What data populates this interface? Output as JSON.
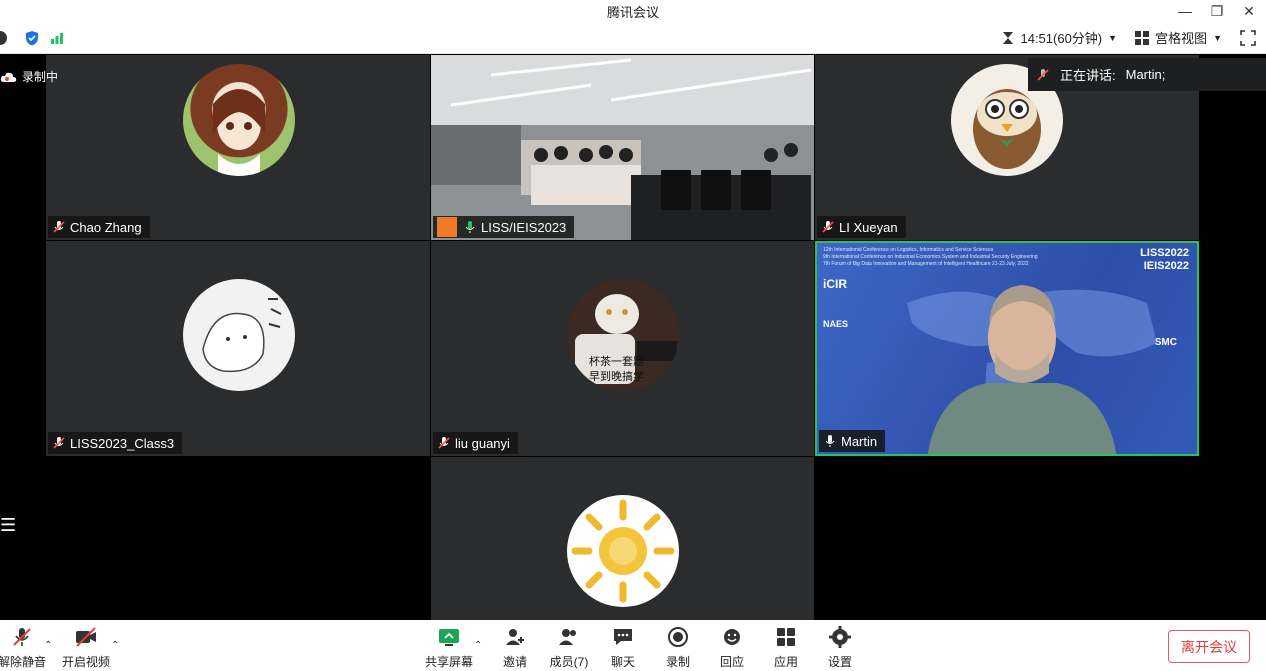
{
  "window": {
    "title": "腾讯会议"
  },
  "top": {
    "time_label": "14:51(60分钟)",
    "view_label": "宫格视图"
  },
  "recording_label": "录制中",
  "speaking": {
    "prefix": "正在讲话:",
    "name": "Martin;"
  },
  "tiles": [
    {
      "name": "Chao Zhang"
    },
    {
      "name": "LISS/IEIS2023"
    },
    {
      "name": "LI Xueyan"
    },
    {
      "name": "LISS2023_Class3"
    },
    {
      "name": "liu guanyi"
    },
    {
      "name": "Martin"
    }
  ],
  "cat_caption": {
    "line1": "杯茶一套题",
    "line2": "早到晚搞学"
  },
  "slide": {
    "logo1": "LISS2022",
    "logo2": "IEIS2022",
    "line1": "12th International Conference on Logistics, Informatics and Service Sciences",
    "line2": "9th International Conference on Industrial Economics System and Industrial Security Engineering",
    "line3": "7th Forum of Big Data Innovation and Management of Intelligent Healthcare  21-23 July, 2022",
    "org1": "iCIR",
    "org2": "NAES",
    "org3": "SMC"
  },
  "bottom": {
    "unmute": "解除静音",
    "video": "开启视频",
    "share": "共享屏幕",
    "invite": "邀请",
    "members": "成员(7)",
    "chat": "聊天",
    "record": "录制",
    "replay": "回应",
    "apps": "应用",
    "settings": "设置",
    "leave": "离开会议"
  },
  "colors": {
    "accent_green": "#22c55e",
    "leave_red": "#e23b3b",
    "tile_bg": "#2b2c2e"
  }
}
